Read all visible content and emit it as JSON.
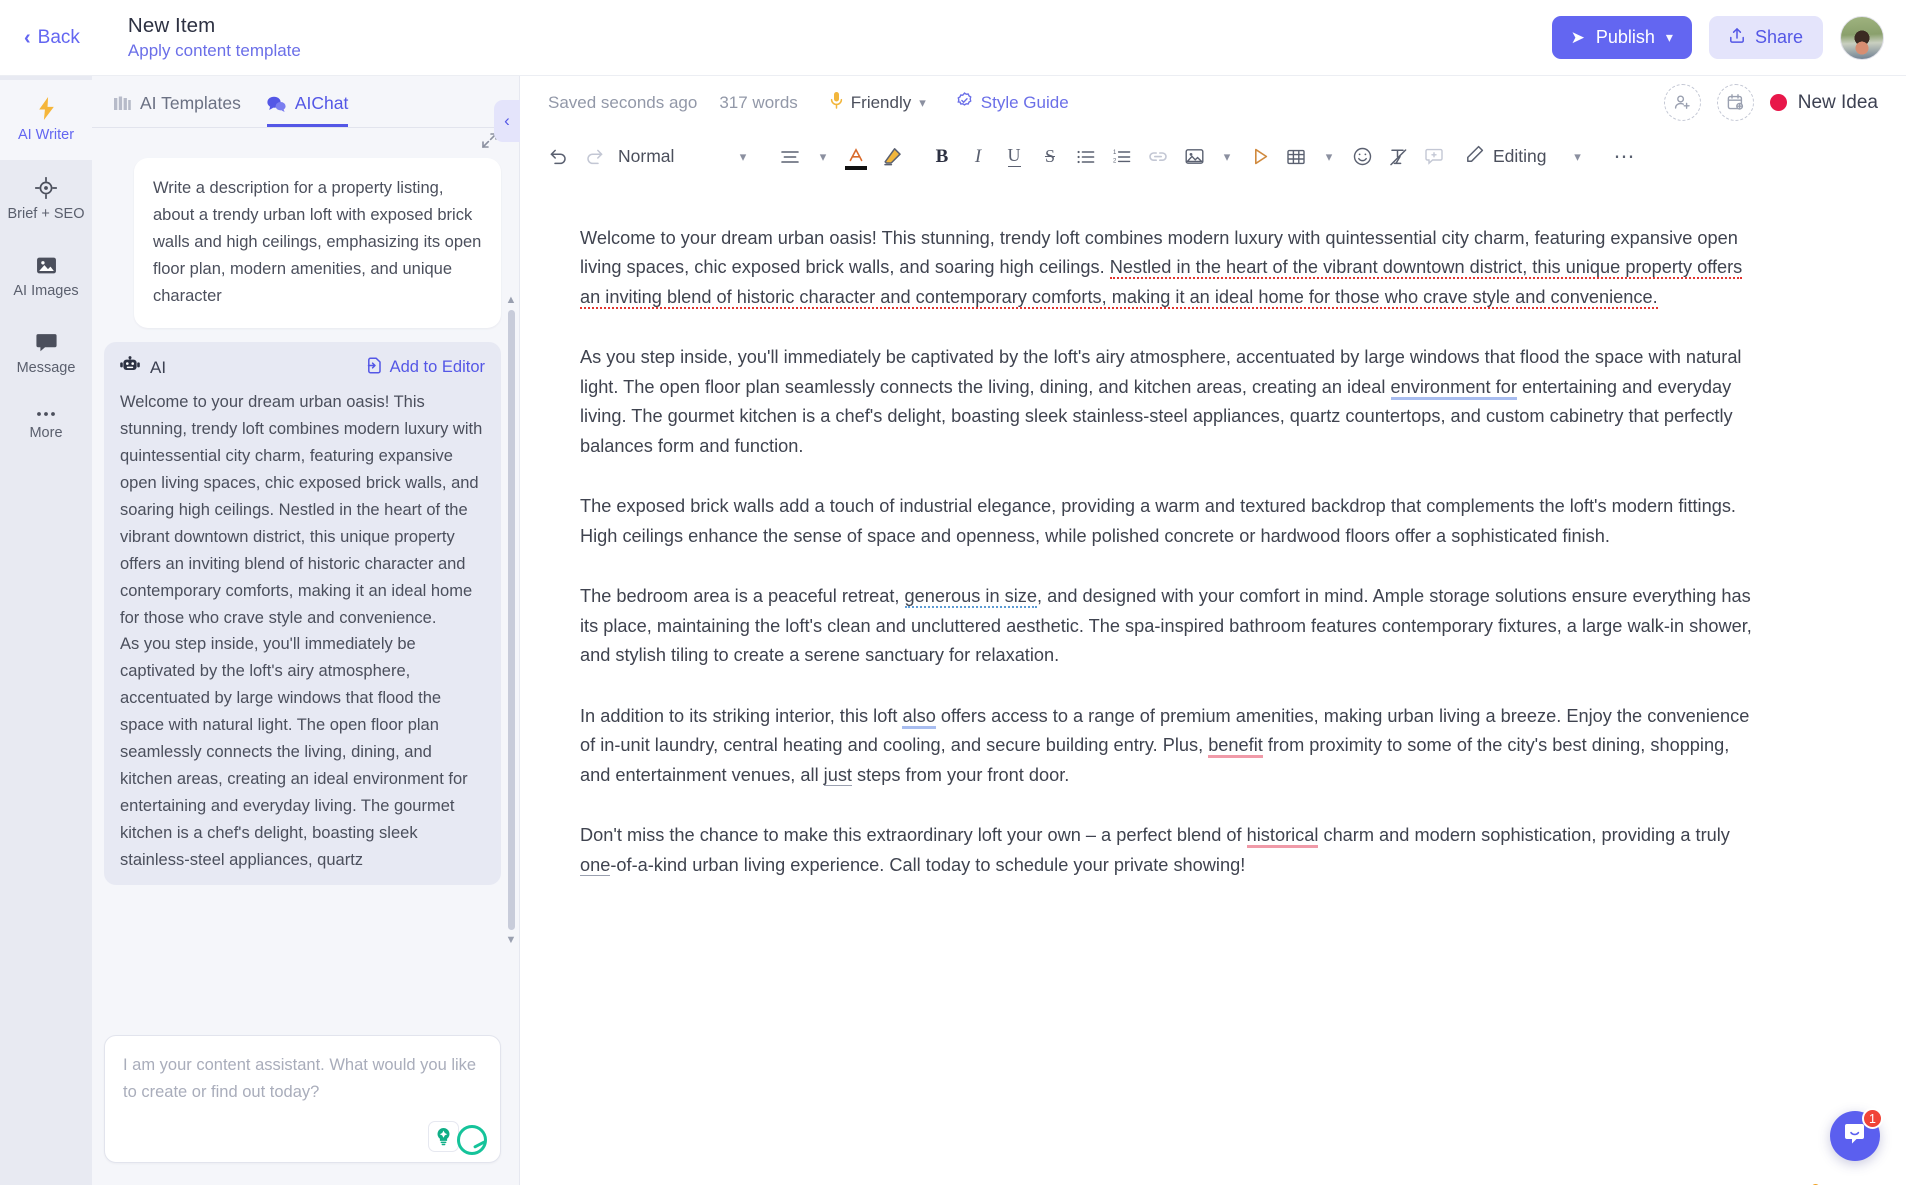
{
  "topbar": {
    "back_label": "Back",
    "doc_title": "New Item",
    "doc_subtitle": "Apply content template",
    "publish_label": "Publish",
    "share_label": "Share",
    "publish_color": "#6366f1",
    "share_bg": "#e4e4fb"
  },
  "rail": {
    "items": [
      {
        "label": "AI Writer",
        "icon": "lightning-icon",
        "active": true
      },
      {
        "label": "Brief + SEO",
        "icon": "target-icon",
        "active": false
      },
      {
        "label": "AI Images",
        "icon": "image-icon",
        "active": false
      },
      {
        "label": "Message",
        "icon": "chat-bubble-icon",
        "active": false
      },
      {
        "label": "More",
        "icon": "ellipsis-icon",
        "active": false
      }
    ]
  },
  "chat": {
    "tabs": [
      {
        "label": "AI Templates",
        "icon": "templates-icon",
        "active": false
      },
      {
        "label": "AIChat",
        "icon": "chat-icon",
        "active": true
      }
    ],
    "user_message": "Write a description for a property listing, about a trendy urban loft with exposed brick walls and high ceilings, emphasizing its open floor plan, modern amenities, and unique character",
    "ai_label": "AI",
    "add_to_editor_label": "Add to Editor",
    "ai_response": "Welcome to your dream urban oasis! This stunning, trendy loft combines modern luxury with quintessential city charm, featuring expansive open living spaces, chic exposed brick walls, and soaring high ceilings. Nestled in the heart of the vibrant downtown district, this unique property offers an inviting blend of historic character and contemporary comforts, making it an ideal home for those who crave style and convenience.\nAs you step inside, you'll immediately be captivated by the loft's airy atmosphere, accentuated by large windows that flood the space with natural light. The open floor plan seamlessly connects the living, dining, and kitchen areas, creating an ideal environment for entertaining and everyday living. The gourmet kitchen is a chef's delight, boasting sleek stainless-steel appliances, quartz",
    "input_placeholder": "I am your content assistant. What would you like to create or find out today?"
  },
  "editor": {
    "status": {
      "saved": "Saved seconds ago",
      "words": "317 words",
      "tone": "Friendly",
      "style_guide": "Style Guide",
      "idea_label": "New Idea",
      "idea_color": "#e8174a"
    },
    "toolbar": {
      "style": "Normal",
      "mode": "Editing",
      "icons": [
        "undo-icon",
        "redo-icon",
        "align-icon",
        "text-color-icon",
        "highlighter-icon",
        "bold-icon",
        "italic-icon",
        "underline-icon",
        "strikethrough-icon",
        "bullet-list-icon",
        "numbered-list-icon",
        "link-icon",
        "image-icon",
        "video-icon",
        "table-icon",
        "emoji-icon",
        "clear-format-icon",
        "comment-icon",
        "pencil-icon",
        "more-icon"
      ]
    },
    "paragraphs": [
      {
        "runs": [
          {
            "text": "Welcome to your dream urban oasis! This stunning, trendy loft combines modern luxury with quintessential city charm, featuring expansive open living spaces, chic exposed brick walls, and soaring high ceilings. ",
            "mark": "none"
          },
          {
            "text": "Nestled in the heart of the vibrant downtown district, this unique property offers an inviting blend of historic character and contemporary comforts, making it an ideal home for those who crave style and convenience.",
            "mark": "red-dotted"
          }
        ]
      },
      {
        "runs": [
          {
            "text": "As you step inside, you'll immediately be captivated by the loft's airy atmosphere, accentuated by large windows that flood the space with natural light. The open floor plan seamlessly connects the living, dining, and kitchen areas, creating an ideal ",
            "mark": "none"
          },
          {
            "text": "environment for",
            "mark": "blue"
          },
          {
            "text": " entertaining and everyday living. The gourmet kitchen is a chef's delight, boasting sleek stainless-steel appliances, quartz countertops, and custom cabinetry that perfectly balances form and function.",
            "mark": "none"
          }
        ]
      },
      {
        "runs": [
          {
            "text": "The exposed brick walls add a touch of industrial elegance, providing a warm and textured backdrop that complements the loft's modern fittings. High ceilings enhance the sense of space and openness, while polished concrete or hardwood floors offer a sophisticated finish.",
            "mark": "none"
          }
        ]
      },
      {
        "runs": [
          {
            "text": "The bedroom area is a peaceful retreat, ",
            "mark": "none"
          },
          {
            "text": "generous in size",
            "mark": "blue-dotted"
          },
          {
            "text": ", and designed with your comfort in mind. Ample storage solutions ensure everything has its place, maintaining the loft's clean and uncluttered aesthetic. The spa-inspired bathroom features contemporary fixtures, a large walk-in shower, and stylish tiling to create a serene sanctuary for relaxation.",
            "mark": "none"
          }
        ]
      },
      {
        "runs": [
          {
            "text": "In addition to its striking interior, this loft ",
            "mark": "none"
          },
          {
            "text": "also",
            "mark": "blue"
          },
          {
            "text": " offers access to a range of premium amenities, making urban living a breeze. Enjoy the convenience of in-unit laundry, central heating and cooling, and secure building entry. Plus, ",
            "mark": "none"
          },
          {
            "text": "benefit",
            "mark": "pink"
          },
          {
            "text": " from proximity to some of the city's best dining, shopping, and entertainment venues, all ",
            "mark": "none"
          },
          {
            "text": "just",
            "mark": "gray"
          },
          {
            "text": " steps from your front door.",
            "mark": "none"
          }
        ]
      },
      {
        "runs": [
          {
            "text": "Don't miss the chance to make this extraordinary loft your own – a perfect blend of ",
            "mark": "none"
          },
          {
            "text": "historical",
            "mark": "pink"
          },
          {
            "text": " charm and modern sophistication, providing a truly ",
            "mark": "none"
          },
          {
            "text": "one",
            "mark": "gray"
          },
          {
            "text": "-of-a-kind urban living experience. Call today to schedule your private showing!",
            "mark": "none"
          }
        ]
      }
    ]
  },
  "widget": {
    "badge": "1",
    "icon": "chat-smile-icon"
  }
}
